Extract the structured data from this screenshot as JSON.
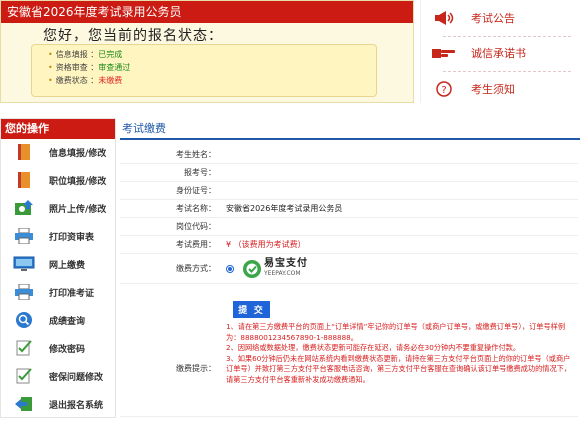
{
  "status_panel": {
    "header": "安徽省2026年度考试录用公务员",
    "greeting": "您好，您当前的报名状态：",
    "rows": [
      {
        "label": "信息填报 ：",
        "value": "已完成",
        "tone": "green"
      },
      {
        "label": "资格审查 ：",
        "value": "审查通过",
        "tone": "green"
      },
      {
        "label": "缴费状态 ：",
        "value": "未缴费",
        "tone": "red"
      }
    ]
  },
  "notices": [
    {
      "label": "考试公告",
      "icon": "megaphone-icon"
    },
    {
      "label": "诚信承诺书",
      "icon": "pointing-hand-icon"
    },
    {
      "label": "考生须知",
      "icon": "question-circle-icon"
    }
  ],
  "menu": {
    "header": "您的操作",
    "items": [
      {
        "label": "信息填报/修改",
        "icon": "book-icon"
      },
      {
        "label": "职位填报/修改",
        "icon": "book-icon"
      },
      {
        "label": "照片上传/修改",
        "icon": "photo-upload-icon"
      },
      {
        "label": "打印资审表",
        "icon": "printer-icon"
      },
      {
        "label": "网上缴费",
        "icon": "monitor-icon"
      },
      {
        "label": "打印准考证",
        "icon": "printer-icon"
      },
      {
        "label": "成绩查询",
        "icon": "search-icon"
      },
      {
        "label": "修改密码",
        "icon": "edit-checklist-icon"
      },
      {
        "label": "密保问题修改",
        "icon": "edit-checklist-icon"
      },
      {
        "label": "退出报名系统",
        "icon": "exit-icon"
      }
    ]
  },
  "payment": {
    "title": "考试缴费",
    "fields": [
      {
        "label": "考生姓名：",
        "value": ""
      },
      {
        "label": "报考号：",
        "value": ""
      },
      {
        "label": "身份证号：",
        "value": ""
      },
      {
        "label": "考试名称：",
        "value": "安徽省2026年度考试录用公务员"
      },
      {
        "label": "岗位代码：",
        "value": ""
      }
    ],
    "fee_label": "考试费用：",
    "fee_value": "¥ （该费用为考试费）",
    "method_label": "缴费方式：",
    "method": {
      "brand_cn": "易宝支付",
      "brand_en": "YEEPAY.COM",
      "selected": true
    },
    "submit_label": "提 交",
    "tips_label": "缴费提示：",
    "tips": [
      "1、请在第三方缴费平台的页面上“订单详情”牢记你的订单号（或商户订单号，或缴费订单号），订单号样例为：8888001234567890-1-888888。",
      "2、因网络或数据处理，缴费状态更新可能存在延迟，请务必在30分钟内不要重复操作付款。",
      "3、如果60分钟后仍未在网站系统内看到缴费状态更新，请持在第三方支付平台页面上的你的订单号（或商户订单号）并致打第三方支付平台客服电话咨询，第三方支付平台客服在查询确认该订单号缴费成功的情况下，请第三方支付平台客重新补发成功缴费通知。"
    ]
  },
  "colors": {
    "brand_red": "#cc1b12",
    "link_blue": "#1f64d8",
    "warning_red": "#d81e1e",
    "status_bg": "#fdf8e0"
  }
}
